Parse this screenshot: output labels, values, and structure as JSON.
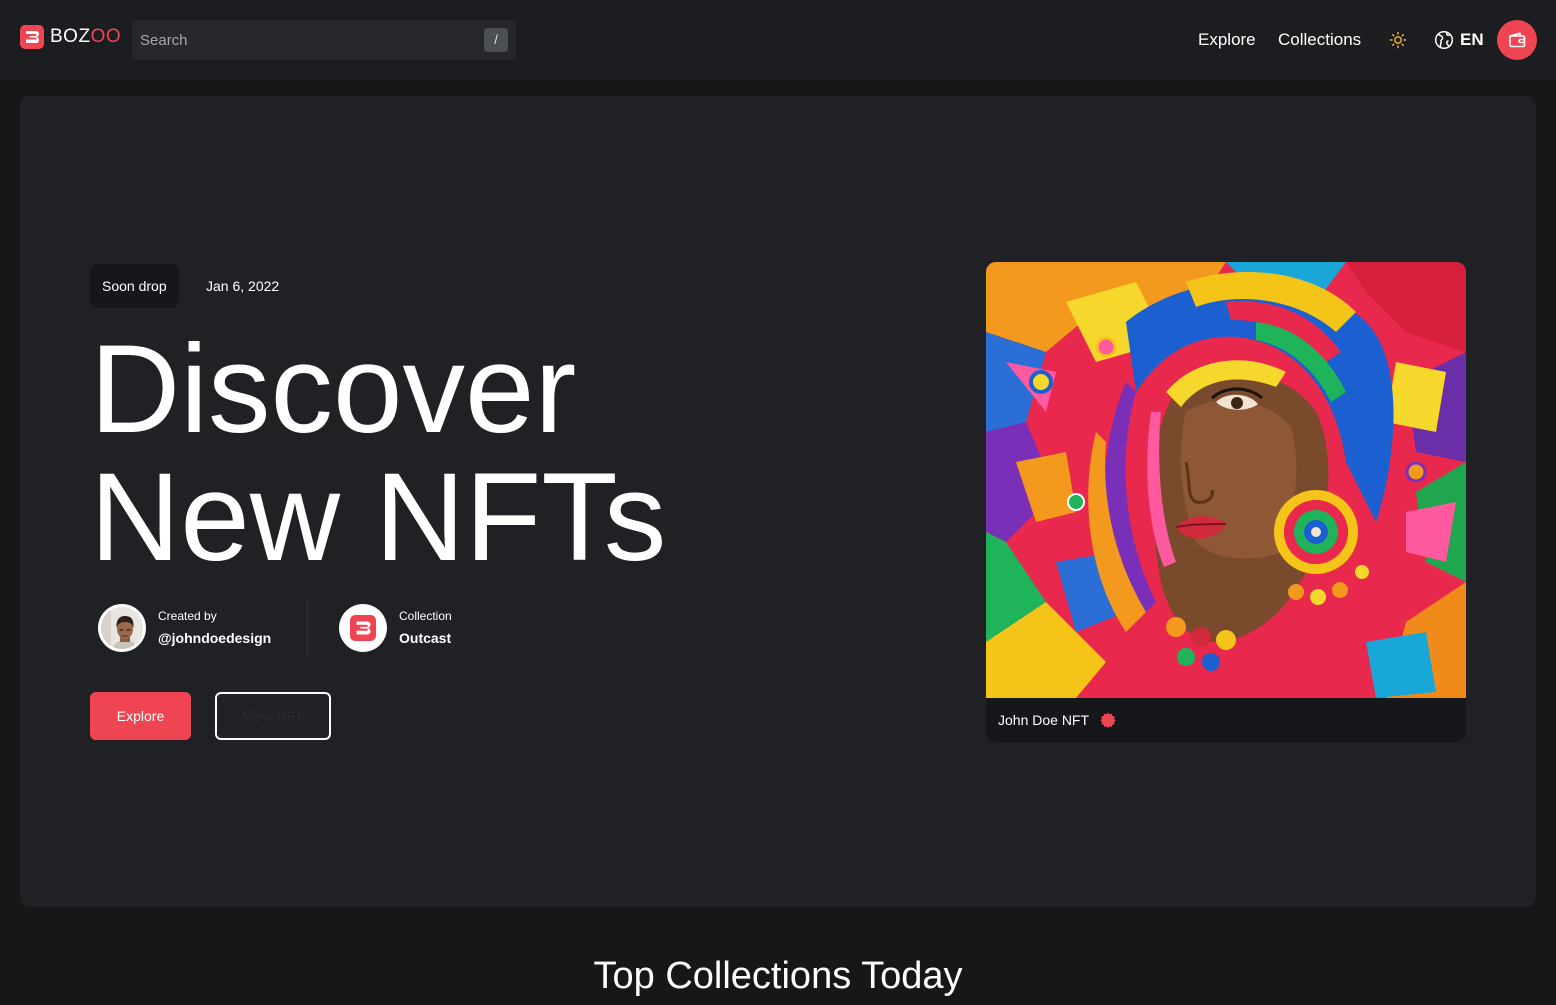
{
  "header": {
    "logo": {
      "text_main": "BOZ",
      "text_accent": "OO"
    },
    "search": {
      "placeholder": "Search",
      "shortcut": "/"
    },
    "nav": {
      "explore": "Explore",
      "collections": "Collections"
    },
    "language": "EN"
  },
  "hero": {
    "badge": "Soon drop",
    "date": "Jan 6, 2022",
    "title_line1": "Discover",
    "title_line2": "New NFTs",
    "creator": {
      "label": "Created by",
      "handle": "@johndoedesign"
    },
    "collection": {
      "label": "Collection",
      "name": "Outcast"
    },
    "buttons": {
      "explore": "Explore",
      "view": "View NFT"
    },
    "nft": {
      "name": "John Doe NFT"
    }
  },
  "top_collections": {
    "title": "Top Collections Today"
  },
  "colors": {
    "accent": "#ef4452",
    "background": "#161719",
    "header": "#1c1d20",
    "hero_panel": "#1f2125"
  },
  "icons": {
    "logo": "bozoo-logo-icon",
    "theme": "sun-icon",
    "language": "globe-icon",
    "wallet": "wallet-icon",
    "verified": "verified-badge-icon"
  }
}
